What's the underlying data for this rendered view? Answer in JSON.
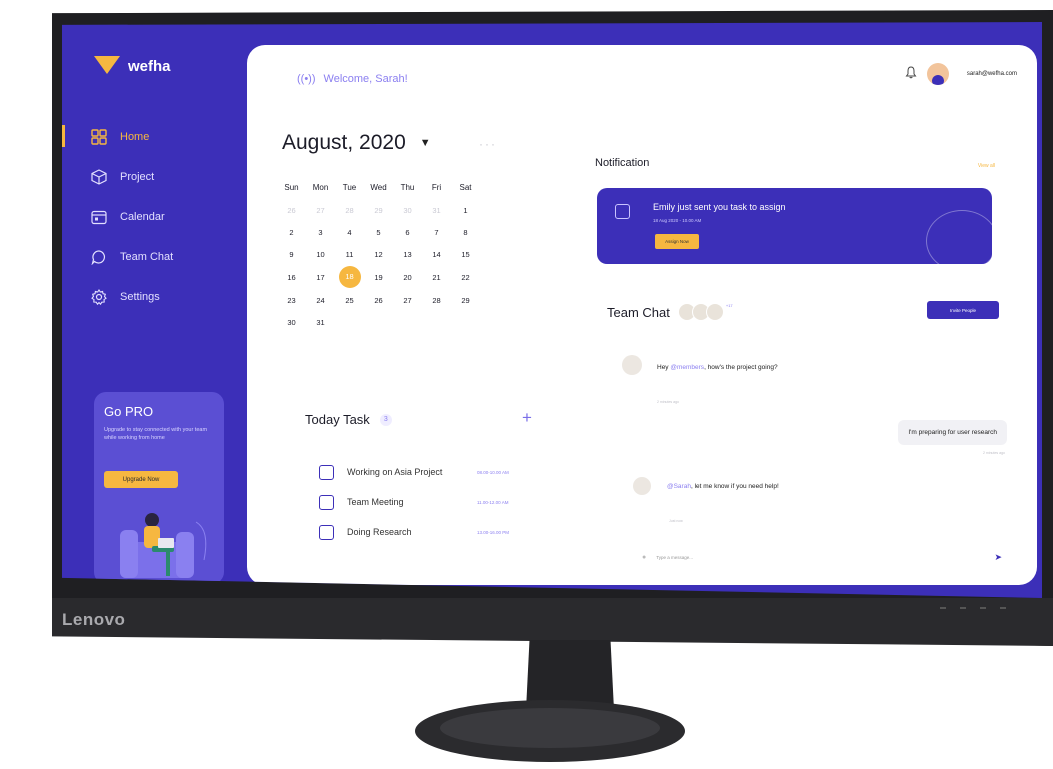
{
  "monitor": {
    "brand": "Lenovo"
  },
  "app": {
    "name": "wefha"
  },
  "sidebar": {
    "items": [
      {
        "label": "Home",
        "icon": "grid-icon",
        "active": true
      },
      {
        "label": "Project",
        "icon": "cube-icon",
        "active": false
      },
      {
        "label": "Calendar",
        "icon": "calendar-icon",
        "active": false
      },
      {
        "label": "Team Chat",
        "icon": "chat-icon",
        "active": false
      },
      {
        "label": "Settings",
        "icon": "gear-icon",
        "active": false
      }
    ]
  },
  "promo": {
    "title": "Go PRO",
    "text": "Upgrade to stay connected with your team while working from home",
    "button": "Upgrade Now"
  },
  "header": {
    "welcome": "Welcome, Sarah!",
    "email": "sarah@wefha.com"
  },
  "calendar": {
    "month_label": "August, 2020",
    "more": "···",
    "weekdays": [
      "Sun",
      "Mon",
      "Tue",
      "Wed",
      "Thu",
      "Fri",
      "Sat"
    ],
    "weeks": [
      [
        "26",
        "27",
        "28",
        "29",
        "30",
        "31",
        "1"
      ],
      [
        "2",
        "3",
        "4",
        "5",
        "6",
        "7",
        "8"
      ],
      [
        "9",
        "10",
        "11",
        "12",
        "13",
        "14",
        "15"
      ],
      [
        "16",
        "17",
        "18",
        "19",
        "20",
        "21",
        "22"
      ],
      [
        "23",
        "24",
        "25",
        "26",
        "27",
        "28",
        "29"
      ],
      [
        "30",
        "31",
        "",
        "",
        "",
        "",
        ""
      ]
    ],
    "selected": "18"
  },
  "today_task": {
    "title": "Today Task",
    "count": "3",
    "add": "+",
    "tasks": [
      {
        "name": "Working on Asia Project",
        "time": "08.00-10.00 AM"
      },
      {
        "name": "Team Meeting",
        "time": "11.00-12.00 AM"
      },
      {
        "name": "Doing Research",
        "time": "13.00-16.00 PM"
      }
    ]
  },
  "notification": {
    "title": "Notification",
    "view_all": "View all",
    "message": "Emily just sent you task to assign",
    "date": "18 Aug 2020 - 10.00 AM",
    "button": "Assign Now"
  },
  "team_chat": {
    "title": "Team Chat",
    "more_members": "+17",
    "invite": "Invite People",
    "messages": [
      {
        "prefix": "Hey ",
        "mention": "@members",
        "text": ", how's the project going?",
        "time": "2 minutes ago"
      },
      {
        "text": "I'm preparing for user research",
        "time": "2 minutes ago"
      },
      {
        "prefix": "",
        "mention": "@Sarah",
        "text": ", let me know if you need help!",
        "time": "Just now"
      }
    ],
    "compose_placeholder": "Type a message...",
    "send_icon": "send-icon"
  },
  "colors": {
    "primary": "#3c2fb8",
    "accent": "#f6b740"
  }
}
